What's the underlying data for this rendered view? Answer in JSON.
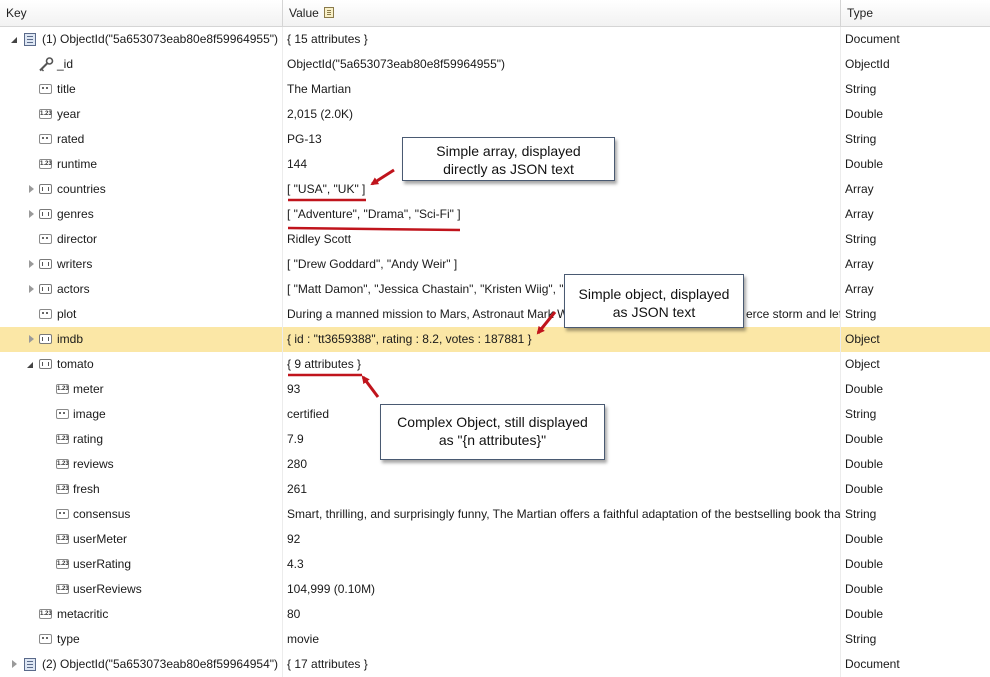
{
  "header": {
    "key": "Key",
    "value": "Value",
    "type": "Type"
  },
  "rows": [
    {
      "key": "(1) ObjectId(\"5a653073eab80e8f59964955\")",
      "value": "{ 15 attributes }",
      "type": "Document",
      "icon": "document-icon"
    },
    {
      "key": "_id",
      "value": "ObjectId(\"5a653073eab80e8f59964955\")",
      "type": "ObjectId",
      "icon": "key-icon"
    },
    {
      "key": "title",
      "value": "The Martian",
      "type": "String",
      "icon": "string-icon"
    },
    {
      "key": "year",
      "value": "2,015 (2.0K)",
      "type": "Double",
      "icon": "number-icon"
    },
    {
      "key": "rated",
      "value": "PG-13",
      "type": "String",
      "icon": "string-icon"
    },
    {
      "key": "runtime",
      "value": "144",
      "type": "Double",
      "icon": "number-icon"
    },
    {
      "key": "countries",
      "value": "[ \"USA\", \"UK\" ]",
      "type": "Array",
      "icon": "array-icon"
    },
    {
      "key": "genres",
      "value": "[ \"Adventure\", \"Drama\", \"Sci-Fi\" ]",
      "type": "Array",
      "icon": "array-icon"
    },
    {
      "key": "director",
      "value": "Ridley Scott",
      "type": "String",
      "icon": "string-icon"
    },
    {
      "key": "writers",
      "value": "[ \"Drew Goddard\", \"Andy Weir\" ]",
      "type": "Array",
      "icon": "array-icon"
    },
    {
      "key": "actors",
      "value": "[ \"Matt Damon\", \"Jessica Chastain\", \"Kristen Wiig\", \"",
      "type": "Array",
      "icon": "array-icon"
    },
    {
      "key": "plot",
      "value": "During a manned mission to Mars, Astronaut Mark W",
      "value_end": "erce storm and lef",
      "type": "String",
      "icon": "string-icon"
    },
    {
      "key": "imdb",
      "value": "{ id : \"tt3659388\", rating : 8.2, votes : 187881 }",
      "type": "Object",
      "icon": "object-icon"
    },
    {
      "key": "tomato",
      "value": "{ 9 attributes }",
      "type": "Object",
      "icon": "object-icon"
    },
    {
      "key": "meter",
      "value": "93",
      "type": "Double",
      "icon": "number-icon"
    },
    {
      "key": "image",
      "value": "certified",
      "type": "String",
      "icon": "string-icon"
    },
    {
      "key": "rating",
      "value": "7.9",
      "type": "Double",
      "icon": "number-icon"
    },
    {
      "key": "reviews",
      "value": "280",
      "type": "Double",
      "icon": "number-icon"
    },
    {
      "key": "fresh",
      "value": "261",
      "type": "Double",
      "icon": "number-icon"
    },
    {
      "key": "consensus",
      "value": "Smart, thrilling, and surprisingly funny, The Martian offers a faithful adaptation of the bestselling book tha",
      "type": "String",
      "icon": "string-icon"
    },
    {
      "key": "userMeter",
      "value": "92",
      "type": "Double",
      "icon": "number-icon"
    },
    {
      "key": "userRating",
      "value": "4.3",
      "type": "Double",
      "icon": "number-icon"
    },
    {
      "key": "userReviews",
      "value": "104,999 (0.10M)",
      "type": "Double",
      "icon": "number-icon"
    },
    {
      "key": "metacritic",
      "value": "80",
      "type": "Double",
      "icon": "number-icon"
    },
    {
      "key": "type",
      "value": "movie",
      "type": "String",
      "icon": "string-icon"
    },
    {
      "key": "(2) ObjectId(\"5a653073eab80e8f59964954\")",
      "value": "{ 17 attributes }",
      "type": "Document",
      "icon": "document-icon"
    }
  ],
  "callouts": {
    "array": {
      "line1": "Simple array, displayed",
      "line2": "directly as JSON text"
    },
    "object": {
      "line1": "Simple object, displayed",
      "line2": "as JSON text"
    },
    "complex": {
      "line1": "Complex Object, still displayed",
      "line2": "as \"{n attributes}\""
    }
  },
  "colors": {
    "selected_row": "#fbe7a6",
    "annotation": "#c0141c",
    "callout_border": "#4a5a72"
  }
}
